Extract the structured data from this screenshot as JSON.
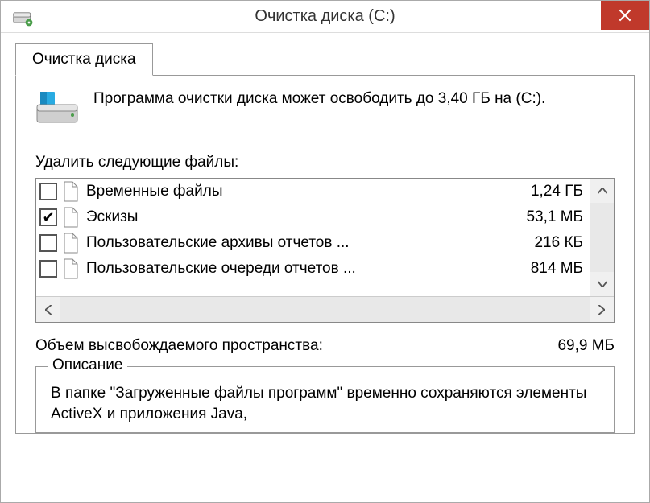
{
  "window": {
    "title": "Очистка диска  (C:)"
  },
  "tab": {
    "label": "Очистка диска"
  },
  "intro": {
    "text": "Программа очистки диска может освободить до 3,40 ГБ на  (C:)."
  },
  "list": {
    "label": "Удалить следующие файлы:",
    "rows": [
      {
        "checked": false,
        "label": "Временные файлы",
        "size": "1,24 ГБ"
      },
      {
        "checked": true,
        "label": "Эскизы",
        "size": "53,1 МБ"
      },
      {
        "checked": false,
        "label": "Пользовательские архивы отчетов ...",
        "size": "216 КБ"
      },
      {
        "checked": false,
        "label": "Пользовательские очереди отчетов ...",
        "size": "814 МБ"
      }
    ]
  },
  "summary": {
    "label": "Объем высвобождаемого пространства:",
    "value": "69,9 МБ"
  },
  "description": {
    "legend": "Описание",
    "text": "В папке \"Загруженные файлы программ\" временно сохраняются элементы ActiveX и приложения Java,"
  }
}
